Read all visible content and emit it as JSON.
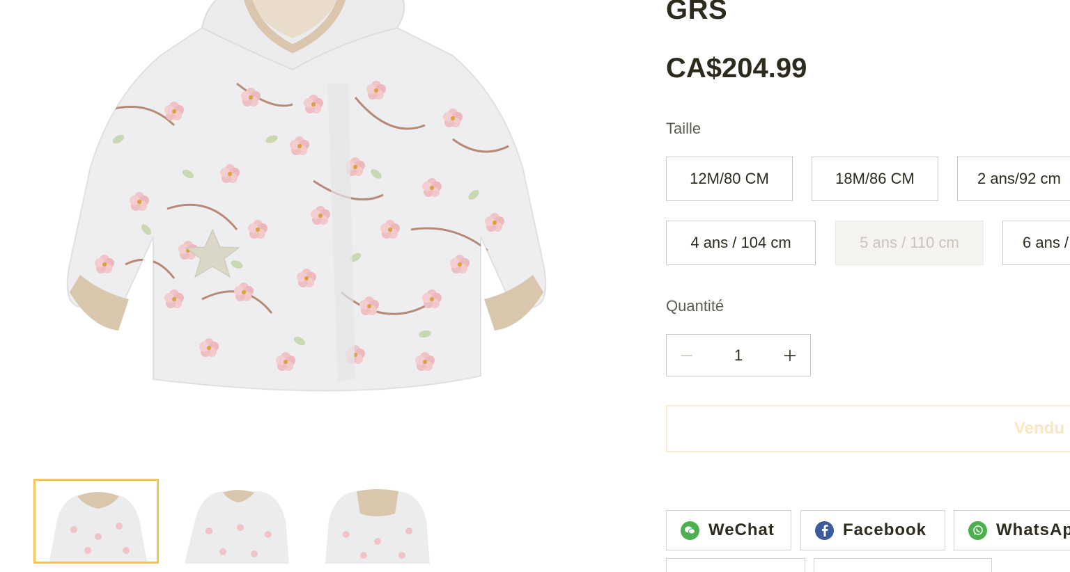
{
  "product": {
    "title": "GRS",
    "price": "CA$204.99"
  },
  "size": {
    "label": "Taille",
    "options": [
      {
        "label": "12M/80 CM",
        "available": true
      },
      {
        "label": "18M/86 CM",
        "available": true
      },
      {
        "label": "2 ans/92 cm",
        "available": true
      },
      {
        "label": "4 ans / 104 cm",
        "available": true
      },
      {
        "label": "5 ans / 110 cm",
        "available": false
      },
      {
        "label": "6 ans /",
        "available": true
      }
    ]
  },
  "quantity": {
    "label": "Quantité",
    "value": "1",
    "decrease_icon": "minus-icon",
    "increase_icon": "plus-icon"
  },
  "purchase": {
    "sold_out_label": "Vendu"
  },
  "share": {
    "buttons": [
      {
        "label": "WeChat",
        "icon": "wechat-icon",
        "color": "#4cb04e"
      },
      {
        "label": "Facebook",
        "icon": "facebook-icon",
        "color": "#3b5b9f"
      },
      {
        "label": "WhatsAp",
        "icon": "whatsapp-icon",
        "color": "#4cb04e"
      }
    ]
  },
  "gallery": {
    "selected_index": 0,
    "thumbnail_count": 3,
    "accent_color": "#f0c65a"
  }
}
